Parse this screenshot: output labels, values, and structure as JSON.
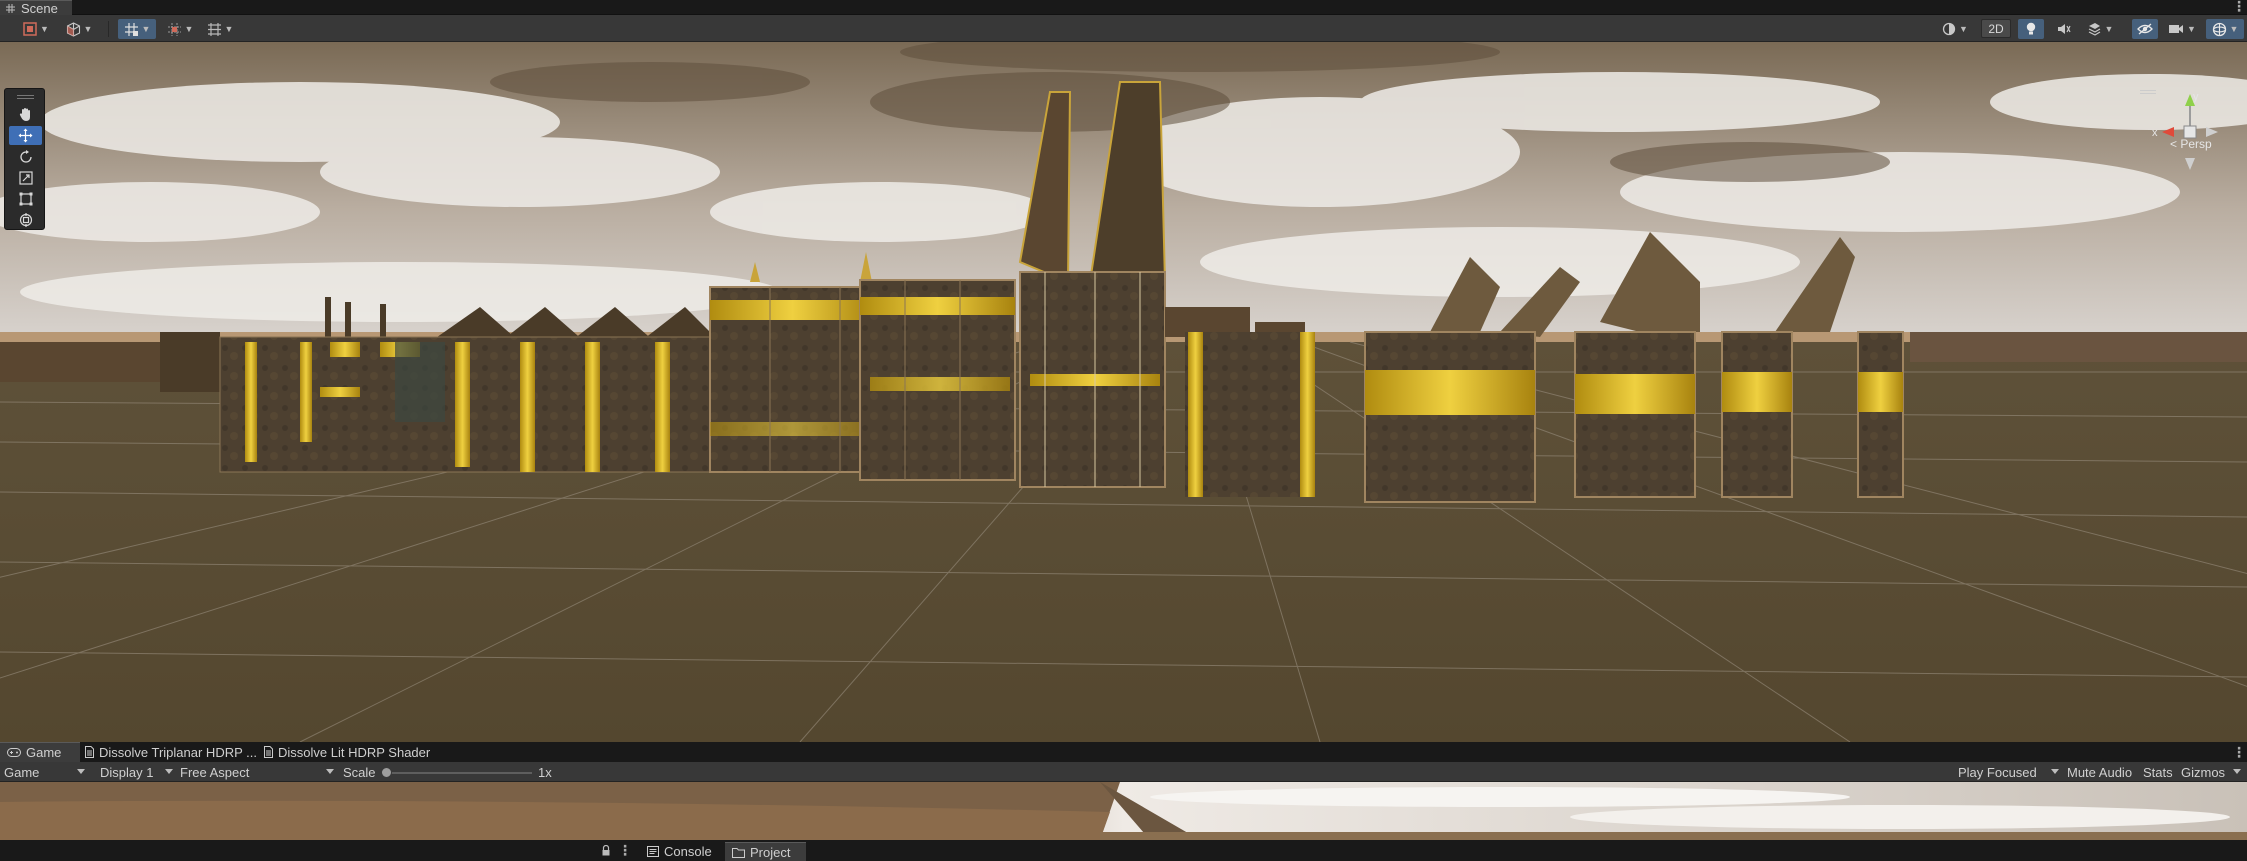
{
  "scene_panel": {
    "tab_label": "Scene",
    "toolbar": {
      "left_buttons": [
        {
          "name": "draw-mode-icon",
          "has_dropdown": true
        },
        {
          "name": "shading-cube-icon",
          "has_dropdown": true
        },
        {
          "name": "grid-snap-icon",
          "has_dropdown": true,
          "active": true
        },
        {
          "name": "increment-snap-icon",
          "has_dropdown": true
        },
        {
          "name": "grid-visibility-icon",
          "has_dropdown": true
        }
      ],
      "mode_2d_label": "2D",
      "right_buttons": [
        {
          "name": "render-mode-icon",
          "has_dropdown": true
        },
        {
          "name": "lighting-icon",
          "active": true
        },
        {
          "name": "audio-icon"
        },
        {
          "name": "effects-icon",
          "has_dropdown": true
        },
        {
          "name": "hidden-objects-icon",
          "active": true
        },
        {
          "name": "camera-icon",
          "has_dropdown": true
        },
        {
          "name": "gizmos-icon",
          "active": true,
          "has_dropdown": true
        }
      ]
    },
    "tools": [
      {
        "name": "hand-tool-icon",
        "active": false
      },
      {
        "name": "move-tool-icon",
        "active": true
      },
      {
        "name": "rotate-tool-icon",
        "active": false
      },
      {
        "name": "scale-tool-icon",
        "active": false
      },
      {
        "name": "rect-tool-icon",
        "active": false
      },
      {
        "name": "transform-tool-icon",
        "active": false
      }
    ],
    "orientation_gizmo": {
      "x_label": "x",
      "y_label": "y",
      "projection_label": "< Persp"
    }
  },
  "game_panel": {
    "tabs": [
      {
        "label": "Game",
        "icon": "gamepad-icon",
        "active": true
      },
      {
        "label": "Dissolve Triplanar HDRP ...",
        "icon": "shader-doc-icon",
        "active": false
      },
      {
        "label": "Dissolve Lit HDRP Shader",
        "icon": "shader-doc-icon",
        "active": false
      }
    ],
    "toolbar": {
      "view_select": "Game",
      "display_select": "Display 1",
      "aspect_select": "Free Aspect",
      "scale_label": "Scale",
      "scale_value": "1x",
      "scale_fraction": 0.0,
      "play_mode_select": "Play Focused",
      "mute_audio_label": "Mute Audio",
      "stats_label": "Stats",
      "gizmos_label": "Gizmos"
    }
  },
  "bottom_tabs": [
    {
      "label": "Console",
      "icon": "console-icon",
      "active": false
    },
    {
      "label": "Project",
      "icon": "folder-icon",
      "active": true
    }
  ],
  "colors": {
    "accent_blue": "#3f6fb6",
    "toolbar_active": "#46607c",
    "panel_bg": "#383838",
    "gold_trim": "#d6b21e"
  }
}
